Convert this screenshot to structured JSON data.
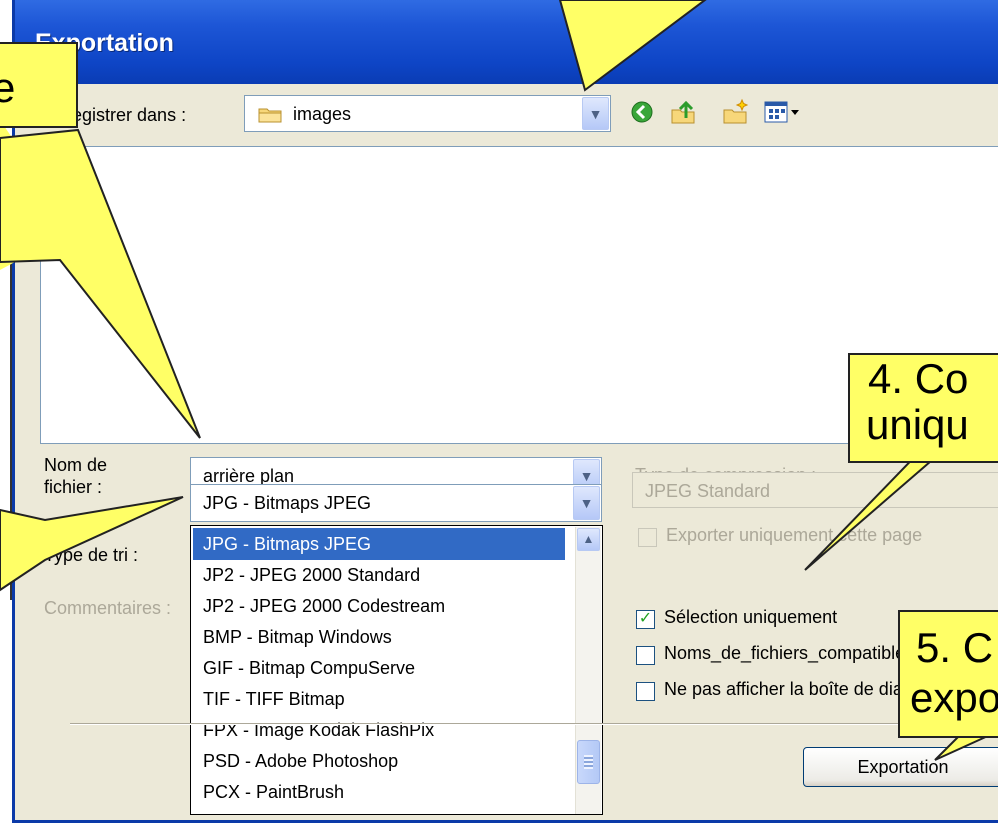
{
  "dialog": {
    "title": "Exportation",
    "save_in_label": "Enregistrer dans :",
    "save_in_value": "images",
    "filename_label_line1": "Nom de",
    "filename_label_line2": "fichier :",
    "filename_value": "arrière plan",
    "filetype_value": "JPG - Bitmaps JPEG",
    "sort_label": "Type de tri :",
    "comments_label": "Commentaires :",
    "compression_label": "Type de compression :",
    "compression_value": "JPEG Standard",
    "export_page_only_label": "Exporter uniquement cette page",
    "selection_only_label": "Sélection uniquement",
    "selection_only_checked": true,
    "compat_names_label": "Noms_de_fichiers_compatibles",
    "no_dialog_label": "Ne pas afficher la boîte de dialogue",
    "export_button": "Exportation"
  },
  "dropdown": {
    "items": [
      "JPG - Bitmaps JPEG",
      "JP2 - JPEG 2000 Standard",
      "JP2 - JPEG 2000 Codestream",
      "BMP - Bitmap Windows",
      "GIF - Bitmap CompuServe",
      "TIF - TIFF Bitmap",
      "FPX -  Image Kodak FlashPix",
      "PSD - Adobe Photoshop",
      "PCX - PaintBrush"
    ],
    "selected_index": 0
  },
  "callouts": {
    "four": "4. Co",
    "four_line2": "uniqu",
    "five": "5. C",
    "five_line2": "expo",
    "left_top": "e"
  },
  "icons": [
    "folder-icon",
    "back-icon",
    "up-folder-icon",
    "new-folder-icon",
    "view-menu-icon"
  ],
  "colors": {
    "titlebar": "#0a3cb4",
    "dialog_bg": "#ece9d8",
    "selection": "#316ac5",
    "callout": "#ffff66"
  }
}
